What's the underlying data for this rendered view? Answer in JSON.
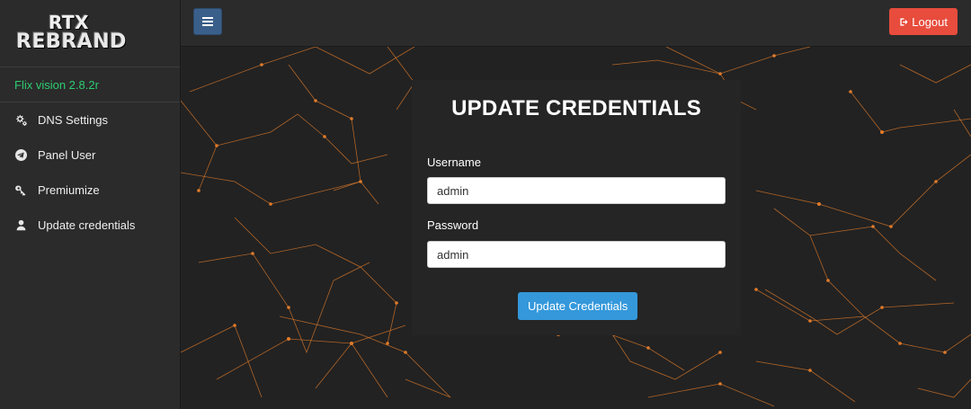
{
  "brand": {
    "logo_line1": "RTX",
    "logo_line2": "REBRAND"
  },
  "version": "Flix vision 2.8.2r",
  "sidebar": {
    "items": [
      {
        "label": "DNS Settings",
        "icon": "gears-icon"
      },
      {
        "label": "Panel User",
        "icon": "telegram-icon"
      },
      {
        "label": "Premiumize",
        "icon": "key-icon"
      },
      {
        "label": "Update credentials",
        "icon": "user-icon"
      }
    ]
  },
  "topbar": {
    "logout_label": "Logout",
    "menu_icon": "hamburger-icon"
  },
  "form": {
    "title": "UPDATE CREDENTIALS",
    "username_label": "Username",
    "username_value": "admin",
    "password_label": "Password",
    "password_value": "admin",
    "submit_label": "Update Credentials"
  },
  "colors": {
    "version": "#2ecc71",
    "logout": "#e74c3c",
    "submit": "#3498db",
    "menu_button": "#3a5f8a",
    "network_lines": "#e07b2a"
  }
}
